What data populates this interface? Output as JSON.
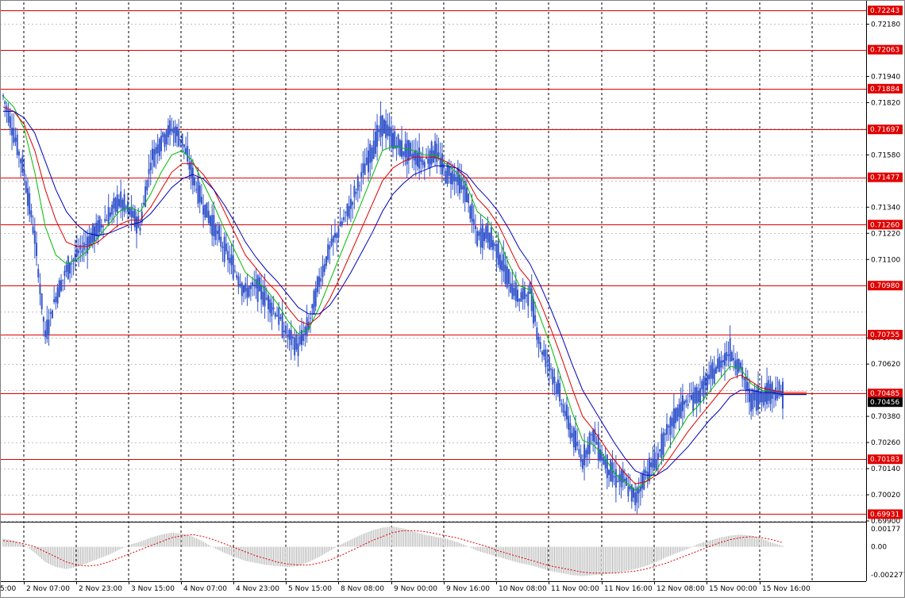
{
  "chart_data": {
    "type": "candlestick",
    "instrument": "",
    "main_panel": {
      "ylim": [
        0.699,
        0.7228
      ],
      "price_ticks": [
        "0.72180",
        "0.71940",
        "0.71820",
        "0.71580",
        "0.71340",
        "0.71220",
        "0.71100",
        "0.70740",
        "0.70620",
        "0.70380",
        "0.70260",
        "0.70140",
        "0.70020",
        "0.69900"
      ],
      "hidden_price_ticks": [
        "0.72060",
        "0.71700",
        "0.71460",
        "0.70980",
        "0.70860",
        "0.70500"
      ],
      "horizontal_levels": [
        "0.72243",
        "0.72063",
        "0.71884",
        "0.71697",
        "0.71477",
        "0.71260",
        "0.70980",
        "0.70755",
        "0.70485",
        "0.69931",
        "0.70183"
      ],
      "current_price": "0.70456",
      "colors": {
        "candle": "#3355cc",
        "level": "#e00000",
        "level_label_bg": "#e00000",
        "current_label_bg": "#000000",
        "ma_fast": "#00bb00",
        "ma_mid": "#dd0000",
        "ma_slow": "#0000bb",
        "grid": "#c0c0c0"
      },
      "series": [
        {
          "name": "Price",
          "values": [
            0.7185,
            0.7168,
            0.715,
            0.712,
            0.7075,
            0.7093,
            0.7105,
            0.7112,
            0.7118,
            0.7124,
            0.713,
            0.7137,
            0.7132,
            0.7125,
            0.7155,
            0.7165,
            0.717,
            0.7165,
            0.7148,
            0.7135,
            0.7125,
            0.7115,
            0.7105,
            0.7095,
            0.7098,
            0.7092,
            0.7085,
            0.7075,
            0.707,
            0.708,
            0.71,
            0.7115,
            0.7125,
            0.7135,
            0.7148,
            0.716,
            0.7172,
            0.7165,
            0.716,
            0.7158,
            0.7155,
            0.716,
            0.715,
            0.7148,
            0.714,
            0.712,
            0.7122,
            0.7113,
            0.71,
            0.7092,
            0.7095,
            0.707,
            0.706,
            0.7045,
            0.703,
            0.7018,
            0.703,
            0.7018,
            0.701,
            0.7008,
            0.7,
            0.7012,
            0.7018,
            0.703,
            0.704,
            0.7045,
            0.7048,
            0.7055,
            0.7062,
            0.7068,
            0.706,
            0.7045,
            0.7048,
            0.705,
            0.7048
          ]
        },
        {
          "name": "MA fast",
          "values": [
            0.7185,
            0.718,
            0.717,
            0.715,
            0.7125,
            0.7112,
            0.7108,
            0.711,
            0.7114,
            0.712,
            0.7126,
            0.7132,
            0.7134,
            0.7132,
            0.714,
            0.715,
            0.7158,
            0.716,
            0.7155,
            0.7145,
            0.7135,
            0.7124,
            0.7114,
            0.7104,
            0.71,
            0.7096,
            0.709,
            0.7082,
            0.7076,
            0.7078,
            0.7088,
            0.71,
            0.7112,
            0.7124,
            0.7136,
            0.7148,
            0.716,
            0.7162,
            0.7161,
            0.716,
            0.7158,
            0.7158,
            0.7154,
            0.715,
            0.7144,
            0.7132,
            0.7128,
            0.712,
            0.7108,
            0.7098,
            0.7096,
            0.7083,
            0.707,
            0.7055,
            0.704,
            0.7027,
            0.7025,
            0.702,
            0.7012,
            0.7008,
            0.7004,
            0.7008,
            0.7013,
            0.7022,
            0.703,
            0.7038,
            0.7043,
            0.7049,
            0.7055,
            0.7061,
            0.706,
            0.7053,
            0.705,
            0.7049,
            0.7048
          ]
        },
        {
          "name": "MA mid",
          "values": [
            0.718,
            0.7178,
            0.7172,
            0.716,
            0.7142,
            0.7128,
            0.7118,
            0.7116,
            0.7116,
            0.7118,
            0.7122,
            0.7126,
            0.7128,
            0.7128,
            0.7134,
            0.7142,
            0.715,
            0.7154,
            0.7154,
            0.7149,
            0.7142,
            0.7132,
            0.7122,
            0.7112,
            0.7106,
            0.71,
            0.7095,
            0.7088,
            0.7082,
            0.708,
            0.7084,
            0.7092,
            0.7102,
            0.7113,
            0.7124,
            0.7135,
            0.7146,
            0.7152,
            0.7155,
            0.7157,
            0.7157,
            0.7157,
            0.7155,
            0.7152,
            0.7147,
            0.7138,
            0.7133,
            0.7126,
            0.7116,
            0.7106,
            0.71,
            0.709,
            0.7078,
            0.7065,
            0.7051,
            0.7038,
            0.7032,
            0.7025,
            0.7018,
            0.7012,
            0.7007,
            0.7008,
            0.7011,
            0.7017,
            0.7024,
            0.7031,
            0.7037,
            0.7043,
            0.7049,
            0.7055,
            0.7057,
            0.7054,
            0.7051,
            0.705,
            0.7049
          ]
        },
        {
          "name": "MA slow",
          "values": [
            0.7178,
            0.7178,
            0.7175,
            0.7168,
            0.7155,
            0.7142,
            0.7132,
            0.7126,
            0.7122,
            0.7121,
            0.7122,
            0.7124,
            0.7126,
            0.7127,
            0.7131,
            0.7137,
            0.7143,
            0.7147,
            0.7149,
            0.7147,
            0.7142,
            0.7135,
            0.7127,
            0.7118,
            0.7111,
            0.7105,
            0.71,
            0.7094,
            0.7088,
            0.7085,
            0.7085,
            0.7089,
            0.7096,
            0.7104,
            0.7113,
            0.7122,
            0.7132,
            0.714,
            0.7145,
            0.7149,
            0.7151,
            0.7153,
            0.7153,
            0.7152,
            0.7149,
            0.7143,
            0.7138,
            0.7132,
            0.7124,
            0.7115,
            0.7108,
            0.7098,
            0.7087,
            0.7075,
            0.7062,
            0.705,
            0.7042,
            0.7034,
            0.7026,
            0.7019,
            0.7013,
            0.7011,
            0.7011,
            0.7014,
            0.7019,
            0.7024,
            0.703,
            0.7036,
            0.7041,
            0.7047,
            0.705,
            0.705,
            0.7049,
            0.7049,
            0.7048
          ]
        }
      ]
    },
    "oscillator_panel": {
      "ylim": [
        -0.00277,
        0.00177
      ],
      "ticks": [
        "0.00177",
        "0.00",
        "-0.002277"
      ],
      "colors": {
        "histogram": "#b0b0b0",
        "signal": "#dd0000"
      },
      "series": [
        {
          "name": "Histogram",
          "values": [
            0.0008,
            0.0006,
            0.0002,
            -0.0006,
            -0.0015,
            -0.002,
            -0.0022,
            -0.002,
            -0.0016,
            -0.0012,
            -0.0008,
            -0.0003,
            0.0002,
            0.0005,
            0.0009,
            0.0012,
            0.0014,
            0.0013,
            0.001,
            0.0005,
            -0.0001,
            -0.0006,
            -0.001,
            -0.0014,
            -0.0016,
            -0.0018,
            -0.0019,
            -0.002,
            -0.0019,
            -0.0015,
            -0.001,
            -0.0004,
            0.0002,
            0.0007,
            0.0012,
            0.0016,
            0.0019,
            0.002,
            0.0018,
            0.0015,
            0.0012,
            0.001,
            0.0008,
            0.0005,
            0.0001,
            -0.0004,
            -0.0007,
            -0.001,
            -0.0013,
            -0.0016,
            -0.0018,
            -0.0021,
            -0.0024,
            -0.0026,
            -0.0028,
            -0.0029,
            -0.0028,
            -0.0027,
            -0.0026,
            -0.0024,
            -0.0022,
            -0.0019,
            -0.0015,
            -0.001,
            -0.0006,
            -0.0002,
            0.0003,
            0.0006,
            0.0009,
            0.0011,
            0.0012,
            0.0011,
            0.0008,
            0.0004,
            0.0001
          ]
        },
        {
          "name": "Signal",
          "values": [
            0.0006,
            0.0005,
            0.0003,
            0.0,
            -0.0005,
            -0.001,
            -0.0015,
            -0.0018,
            -0.0019,
            -0.0018,
            -0.0015,
            -0.0011,
            -0.0007,
            -0.0003,
            0.0001,
            0.0005,
            0.0009,
            0.0011,
            0.0012,
            0.001,
            0.0007,
            0.0003,
            -0.0001,
            -0.0005,
            -0.0009,
            -0.0012,
            -0.0015,
            -0.0017,
            -0.0018,
            -0.0018,
            -0.0016,
            -0.0013,
            -0.0009,
            -0.0004,
            0.0001,
            0.0006,
            0.001,
            0.0014,
            0.0016,
            0.0016,
            0.0015,
            0.0013,
            0.0011,
            0.0009,
            0.0006,
            0.0003,
            0.0,
            -0.0004,
            -0.0007,
            -0.001,
            -0.0013,
            -0.0016,
            -0.0019,
            -0.0021,
            -0.0023,
            -0.0025,
            -0.0026,
            -0.0026,
            -0.0026,
            -0.0025,
            -0.0024,
            -0.0022,
            -0.0019,
            -0.0016,
            -0.0012,
            -0.0008,
            -0.0004,
            0.0,
            0.0004,
            0.0007,
            0.0009,
            0.001,
            0.0009,
            0.0007,
            0.0004
          ]
        }
      ]
    },
    "time_labels": [
      "5:00",
      "2 Nov 07:00",
      "2 Nov 23:00",
      "3 Nov 15:00",
      "4 Nov 07:00",
      "4 Nov 23:00",
      "5 Nov 15:00",
      "8 Nov 08:00",
      "9 Nov 00:00",
      "9 Nov 16:00",
      "10 Nov 08:00",
      "11 Nov 00:00",
      "11 Nov 16:00",
      "12 Nov 08:00",
      "15 Nov 00:00",
      "15 Nov 16:00"
    ],
    "grid": true
  }
}
